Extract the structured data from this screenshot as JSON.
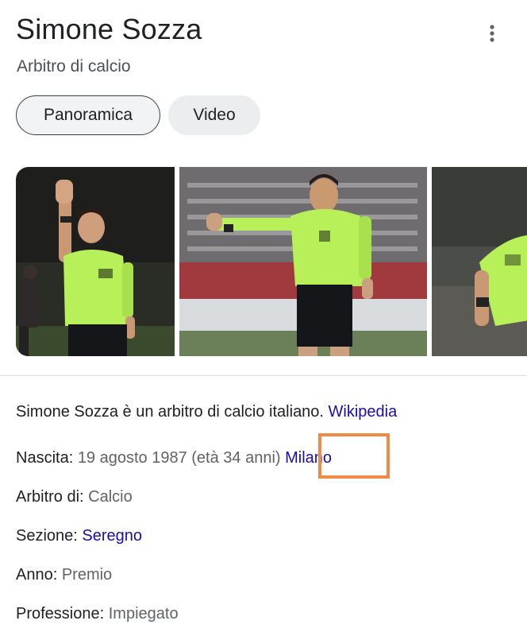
{
  "header": {
    "title": "Simone Sozza",
    "subtitle": "Arbitro di calcio",
    "more_icon": "more-vert-icon"
  },
  "tabs": [
    {
      "label": "Panoramica",
      "active": true
    },
    {
      "label": "Video",
      "active": false
    }
  ],
  "images": [
    {
      "alt": "referee-raising-hand"
    },
    {
      "alt": "referee-pointing"
    },
    {
      "alt": "referee-partial"
    }
  ],
  "description": {
    "text": "Simone Sozza è un arbitro di calcio italiano. ",
    "source_link": "Wikipedia"
  },
  "facts": {
    "birth": {
      "label": "Nascita: ",
      "value": "19 agosto 1987 (età 34 anni) ",
      "link": "Milano"
    },
    "referee_of": {
      "label": "Arbitro di: ",
      "value": "Calcio"
    },
    "section": {
      "label": "Sezione: ",
      "link": "Seregno"
    },
    "year": {
      "label": "Anno: ",
      "value": "Premio"
    },
    "profession": {
      "label": "Professione: ",
      "value": "Impiegato"
    }
  },
  "colors": {
    "link": "#1a0dab",
    "highlight": "#f08a45",
    "text": "#202124",
    "muted": "#5f6368",
    "referee_shirt": "#b8f05a"
  }
}
